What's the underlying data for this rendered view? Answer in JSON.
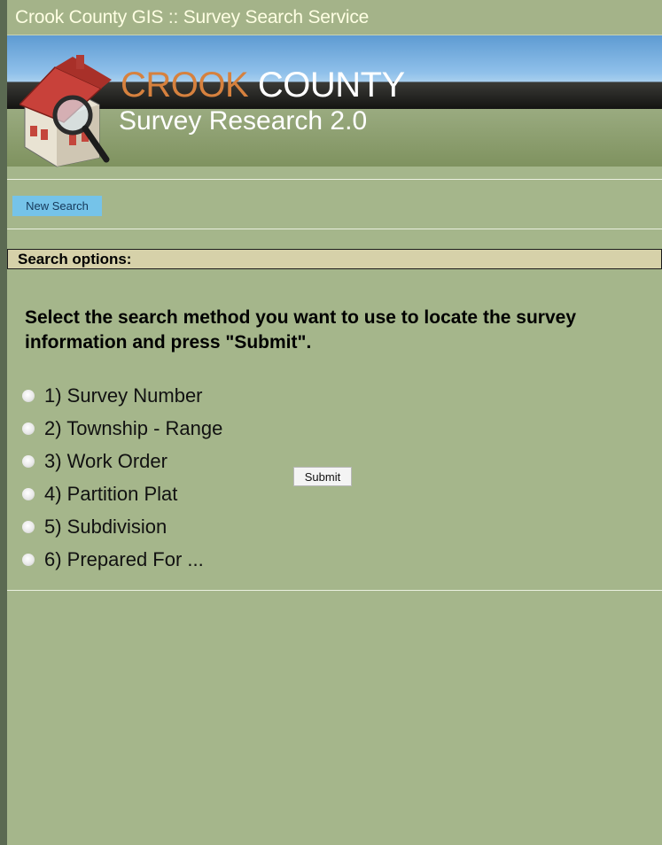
{
  "window": {
    "title": "Crook County GIS :: Survey Search Service"
  },
  "banner": {
    "brand_part1": "CROOK",
    "brand_part2": "COUNTY",
    "subtitle": "Survey Research 2.0"
  },
  "toolbar": {
    "new_search_label": "New Search"
  },
  "search_options": {
    "header": "Search options:",
    "instructions": "Select the search method you want to use to locate the survey information and press \"Submit\".",
    "options": [
      {
        "label": "1) Survey Number",
        "selected": false
      },
      {
        "label": "2) Township - Range",
        "selected": false
      },
      {
        "label": "3) Work Order",
        "selected": false
      },
      {
        "label": "4) Partition Plat",
        "selected": false
      },
      {
        "label": "5) Subdivision",
        "selected": false
      },
      {
        "label": "6) Prepared For ...",
        "selected": false
      }
    ],
    "submit_label": "Submit"
  },
  "colors": {
    "page_background": "#a5b68b",
    "header_band": "#d6d1a9",
    "new_search_button": "#75c3e9",
    "brand_orange": "#d6813e"
  },
  "icons": {
    "logo": "house-with-magnifier-icon"
  }
}
